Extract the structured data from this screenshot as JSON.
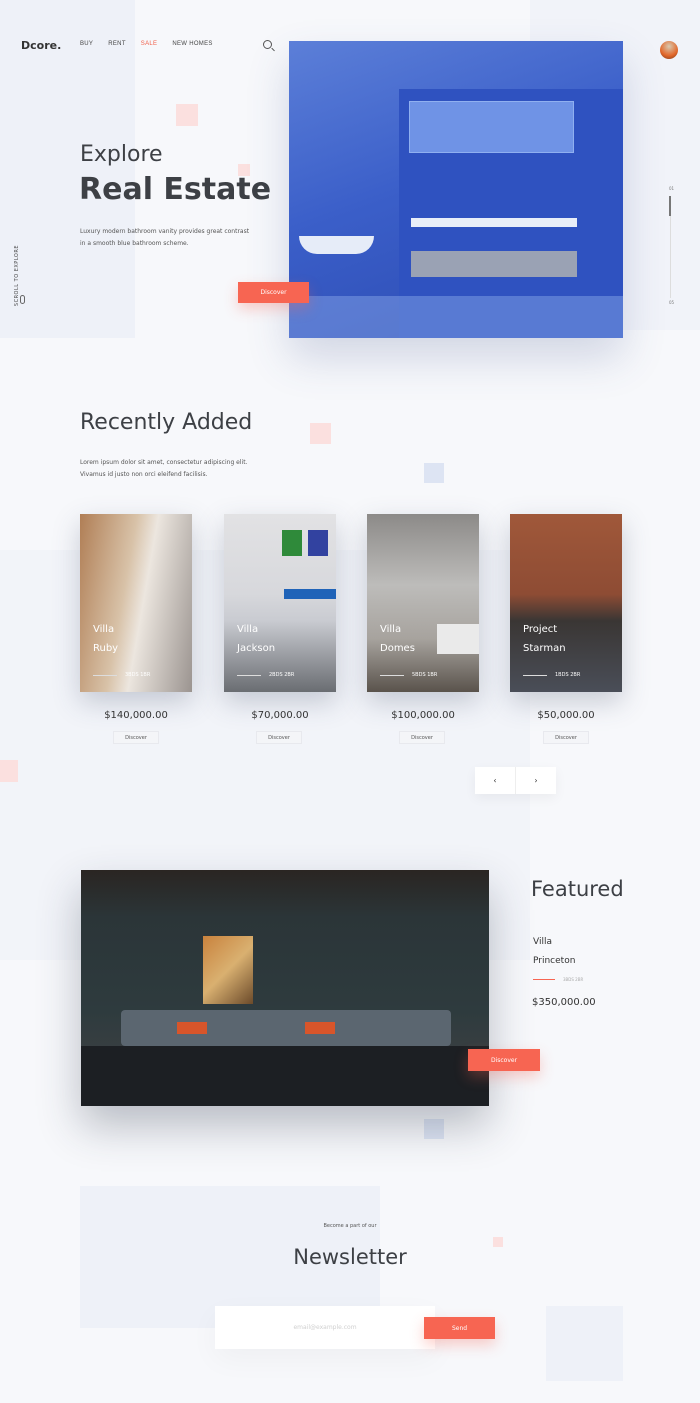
{
  "brand": "Dcore.",
  "nav": [
    {
      "label": "BUY"
    },
    {
      "label": "RENT"
    },
    {
      "label": "SALE",
      "active": true
    },
    {
      "label": "NEW HOMES"
    }
  ],
  "hero": {
    "title_line1": "Explore",
    "title_line2": "Real Estate",
    "description": "Luxury modern bathroom vanity provides great contrast in a smooth blue bathroom scheme.",
    "button": "Discover",
    "scroll_hint": "SCROLL TO EXPLORE",
    "slide_current": "01",
    "slide_total": "05"
  },
  "recent": {
    "title": "Recently Added",
    "description": "Lorem ipsum dolor sit amet, consectetur adipiscing elit. Vivamus id justo non orci eleifend facilisis.",
    "cards": [
      {
        "line1": "Villa",
        "line2": "Ruby",
        "meta": "3BDS 1BR",
        "price": "$140,000.00",
        "button": "Discover"
      },
      {
        "line1": "Villa",
        "line2": "Jackson",
        "meta": "2BDS 2BR",
        "price": "$70,000.00",
        "button": "Discover"
      },
      {
        "line1": "Villa",
        "line2": "Domes",
        "meta": "5BDS 1BR",
        "price": "$100,000.00",
        "button": "Discover"
      },
      {
        "line1": "Project",
        "line2": "Starman",
        "meta": "1BDS 2BR",
        "price": "$50,000.00",
        "button": "Discover"
      }
    ],
    "prev": "‹",
    "next": "›"
  },
  "featured": {
    "title": "Featured",
    "line1": "Villa",
    "line2": "Princeton",
    "meta": "3BDS 2BR",
    "price": "$350,000.00",
    "button": "Discover"
  },
  "newsletter": {
    "subtitle": "Become a part of our",
    "title": "Newsletter",
    "placeholder": "email@example.com",
    "button": "Send"
  },
  "colors": {
    "accent": "#f76552",
    "text": "#3d4045",
    "background": "#f7f8fb"
  }
}
